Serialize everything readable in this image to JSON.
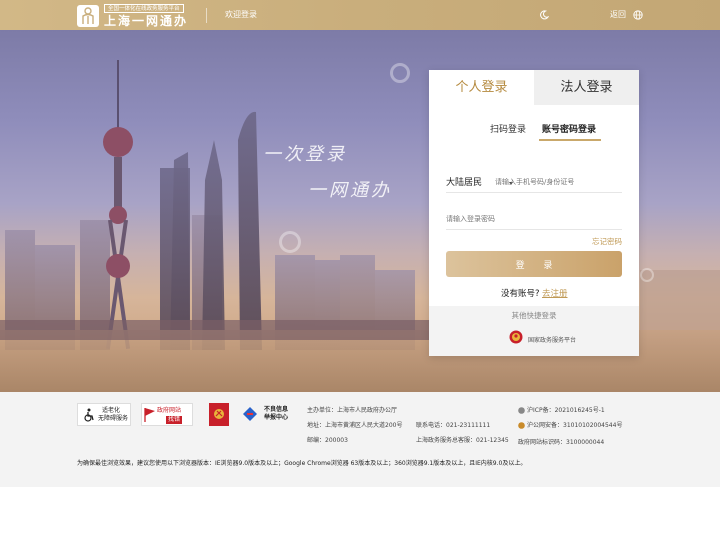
{
  "header": {
    "logo_tag": "全国一体化在线政务服务平台",
    "logo_title": "上海一网通办",
    "welcome": "欢迎登录",
    "back": "返回",
    "theme_icon": "moon-icon",
    "language_icon": "globe-icon"
  },
  "hero": {
    "slogan_line1": "一次登录",
    "slogan_line2": "一网通办"
  },
  "login": {
    "tabs": [
      {
        "label": "个人登录",
        "active": true
      },
      {
        "label": "法人登录",
        "active": false
      }
    ],
    "subtabs": [
      {
        "label": "扫码登录",
        "active": false
      },
      {
        "label": "账号密码登录",
        "active": true
      }
    ],
    "resident_type": "大陆居民",
    "phone_placeholder": "请输入手机号码/身份证号",
    "password_placeholder": "请输入登录密码",
    "forgot_password": "忘记密码",
    "login_button": "登 录",
    "no_account": "没有账号?",
    "register": "去注册",
    "other_login_title": "其他快捷登录",
    "gov_platform": "国家政务服务平台"
  },
  "footer": {
    "badges": {
      "accessibility_line1": "适老化",
      "accessibility_line2": "无障碍服务",
      "gov_site_line1": "政府网站",
      "gov_site_line2": "找错",
      "report_line1": "不良信息",
      "report_line2": "举报中心"
    },
    "host": "主办单位：上海市人民政府办公厅",
    "address": "地址：上海市黄浦区人民大道200号",
    "postcode": "邮编：200003",
    "phone": "联系电话：021-23111111",
    "hotline": "上海政务服务总客服：021-12345",
    "icp": "沪ICP备：2021016245号-1",
    "police": "沪公网安备：31010102004544号",
    "site_code": "政府网站标识码：3100000044",
    "browser_note": "为确保最佳浏览效果，建议您使用以下浏览器版本：IE浏览器9.0版本及以上；Google Chrome浏览器 63版本及以上；360浏览器9.1版本及以上，且IE内核9.0及以上。"
  },
  "colors": {
    "header_gold": "#c9ae7c",
    "accent_gold": "#b58a3f",
    "link_gold": "#c09a56",
    "footer_bg": "#f3f3f3"
  }
}
